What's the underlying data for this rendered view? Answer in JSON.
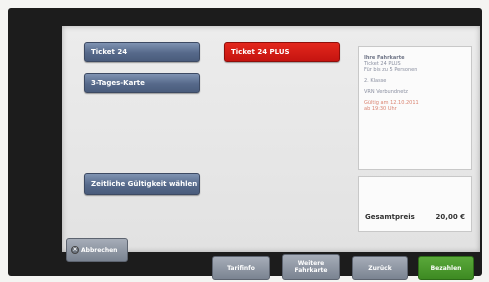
{
  "tickets": {
    "ticket_24": "Ticket 24",
    "ticket_24_plus": "Ticket 24 PLUS",
    "three_day": "3-Tages-Karte",
    "time_validity": "Zeitliche Gültigkeit wählen"
  },
  "summary": {
    "lines": [
      {
        "text": "Ihre Fahrkarte",
        "style": "title"
      },
      {
        "text": "Ticket 24 PLUS",
        "style": "normal"
      },
      {
        "text": "Für bis zu 5 Personen",
        "style": "normal"
      },
      {
        "text": "",
        "style": "gap"
      },
      {
        "text": "2. Klasse",
        "style": "normal"
      },
      {
        "text": "",
        "style": "gap"
      },
      {
        "text": "VRN Verbundnetz",
        "style": "normal"
      },
      {
        "text": "",
        "style": "gap"
      },
      {
        "text": "Gültig am 12.10.2011",
        "style": "red"
      },
      {
        "text": "ab 19:30 Uhr",
        "style": "red"
      }
    ],
    "total_label": "Gesamtpreis",
    "total_value": "20,00 €"
  },
  "footer": {
    "cancel": "Abbrechen",
    "tariff_info": "Tarifinfo",
    "more_tickets": "Weitere\nFahrkarte",
    "back": "Zurück",
    "pay": "Bezahlen"
  },
  "colors": {
    "selected": "#d01a14",
    "default_button": "#5c6f90",
    "pay_button": "#4a9a2c"
  }
}
